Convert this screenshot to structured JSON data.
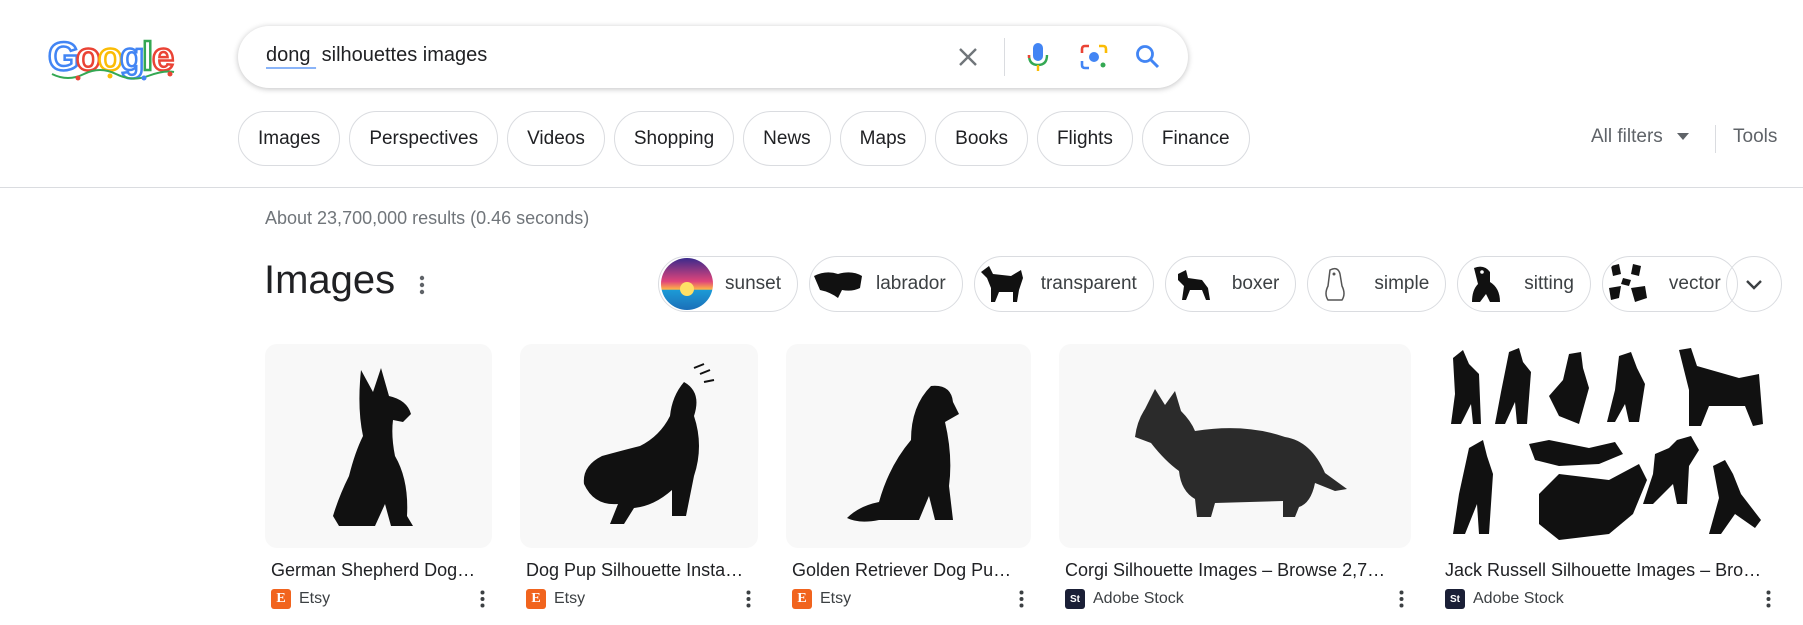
{
  "search": {
    "query_underlined": "dong ",
    "query_rest": " silhouettes images"
  },
  "tabs": [
    "Images",
    "Perspectives",
    "Videos",
    "Shopping",
    "News",
    "Maps",
    "Books",
    "Flights",
    "Finance"
  ],
  "filters": {
    "all_filters": "All filters",
    "tools": "Tools"
  },
  "stats": "About 23,700,000 results (0.46 seconds)",
  "images_section": {
    "title": "Images",
    "refinements": [
      "sunset",
      "labrador",
      "transparent",
      "boxer",
      "simple",
      "sitting",
      "vector"
    ]
  },
  "results": [
    {
      "title": "German Shepherd Dog…",
      "source": "Etsy",
      "icon": "etsy-icon"
    },
    {
      "title": "Dog Pup Silhouette Insta…",
      "source": "Etsy",
      "icon": "etsy-icon"
    },
    {
      "title": "Golden Retriever Dog Pu…",
      "source": "Etsy",
      "icon": "etsy-icon"
    },
    {
      "title": "Corgi Silhouette Images – Browse 2,7…",
      "source": "Adobe Stock",
      "icon": "adobe-stock-icon"
    },
    {
      "title": "Jack Russell Silhouette Images – Bro…",
      "source": "Adobe Stock",
      "icon": "adobe-stock-icon"
    }
  ],
  "colors": {
    "google_blue": "#4285f4",
    "google_red": "#ea4335",
    "google_yellow": "#fbbc05",
    "google_green": "#34a853",
    "etsy": "#f1641e",
    "adobe_stock": "#1a1f36"
  }
}
